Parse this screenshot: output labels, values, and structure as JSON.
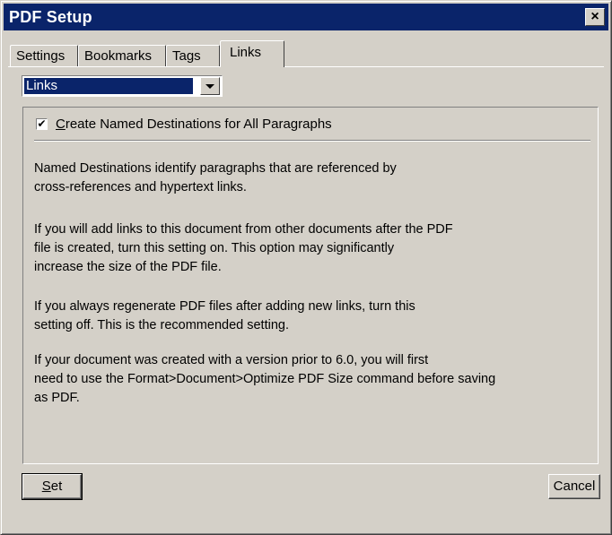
{
  "window": {
    "title": "PDF Setup",
    "close_label": "×"
  },
  "tabs": [
    {
      "label": "Settings",
      "active": false
    },
    {
      "label": "Bookmarks",
      "active": false
    },
    {
      "label": "Tags",
      "active": false
    },
    {
      "label": "Links",
      "active": true
    }
  ],
  "dropdown": {
    "selected": "Links"
  },
  "panel": {
    "checkbox": {
      "checked": true,
      "mnemonic": "C",
      "label_rest": "reate Named Destinations for All Paragraphs"
    },
    "paragraphs": [
      {
        "line1": "Named Destinations identify paragraphs that are referenced by",
        "line2": "cross-references and hypertext links."
      },
      {
        "line1": "If you will add links to this document from other documents after the PDF",
        "line2": "file is created, turn this setting on.  This option may significantly",
        "line3": "increase the size of the PDF file."
      },
      {
        "line1": "If you always regenerate PDF files after adding new links, turn this",
        "line2": "setting off.  This is the recommended setting."
      },
      {
        "line1": "If your document was created with a version prior to 6.0, you will first",
        "line2": "need to use the Format>Document>Optimize PDF Size command before saving",
        "line3": "as PDF."
      }
    ]
  },
  "buttons": {
    "set_mnemonic": "S",
    "set_rest": "et",
    "cancel": "Cancel"
  }
}
